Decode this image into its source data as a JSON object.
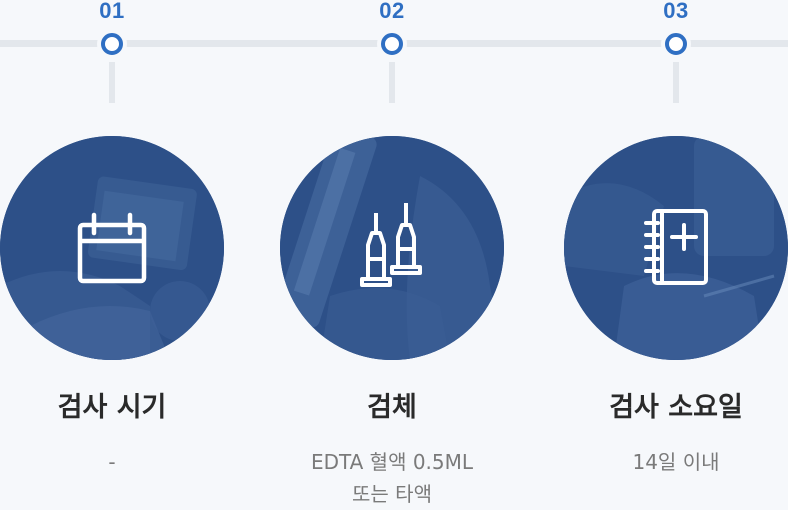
{
  "colors": {
    "accent": "#2f6fc3",
    "circle_overlay": "#2e5288",
    "line": "#e3e7ec",
    "title_text": "#2a2a2a",
    "desc_text": "#7a7a7a"
  },
  "steps": [
    {
      "number": "01",
      "icon": "calendar-icon",
      "title": "검사 시기",
      "desc": [
        "-"
      ]
    },
    {
      "number": "02",
      "icon": "syringes-icon",
      "title": "검체",
      "desc": [
        "EDTA 혈액 0.5ML",
        "또는 타액"
      ]
    },
    {
      "number": "03",
      "icon": "medical-notebook-icon",
      "title": "검사 소요일",
      "desc": [
        "14일 이내"
      ]
    }
  ]
}
